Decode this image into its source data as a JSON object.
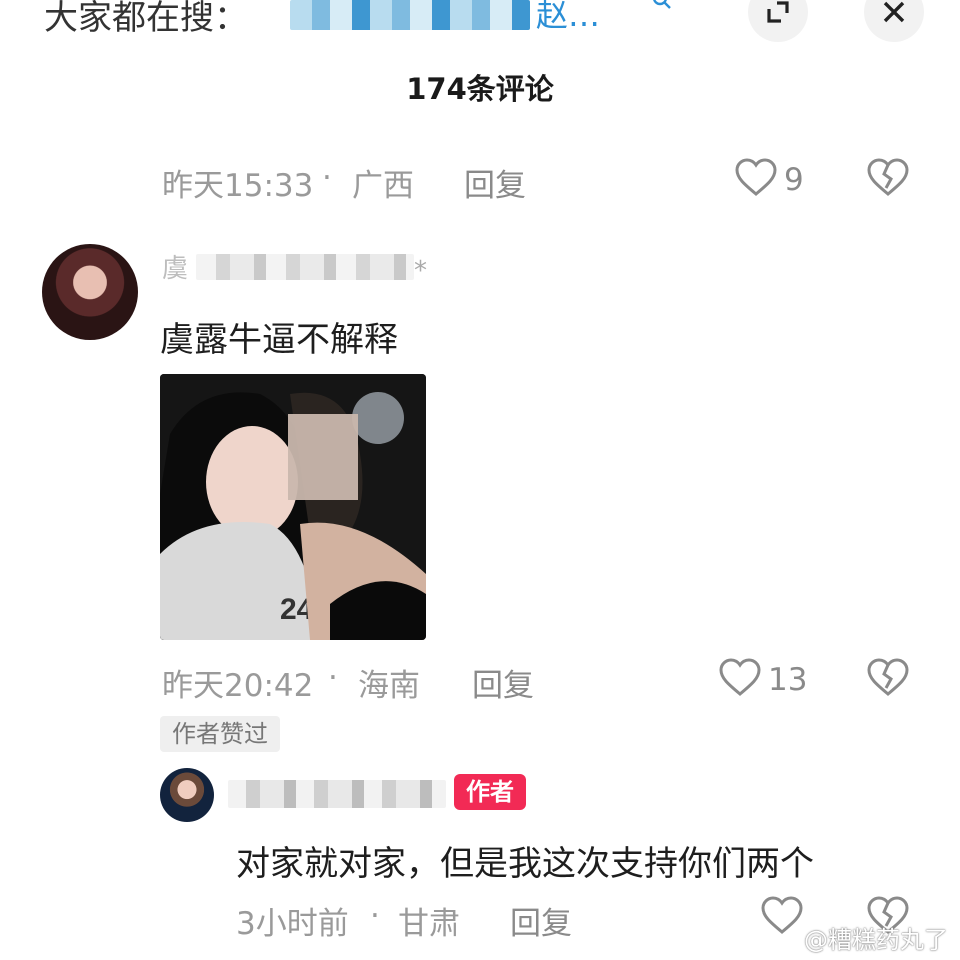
{
  "header": {
    "search_prefix": "大家都在搜：",
    "search_suffix": "赵…",
    "comment_count": "174条评论"
  },
  "comment_prev": {
    "time": "昨天15:33",
    "location": "广西",
    "reply_label": "回复",
    "likes": "9"
  },
  "comment_main": {
    "username_visible": "虞",
    "text": "虞露牛逼不解释",
    "time": "昨天20:42",
    "location": "海南",
    "reply_label": "回复",
    "likes": "13",
    "author_liked_badge": "作者赞过"
  },
  "reply": {
    "author_badge": "作者",
    "text": "对家就对家，但是我这次支持你们两个",
    "time": "3小时前",
    "location": "甘肃",
    "reply_label": "回复"
  },
  "separator": "·",
  "watermark": "@糟糕药丸了",
  "colors": {
    "author_badge": "#f22a55",
    "search_link": "#2b8fd6",
    "meta_gray": "#9a9a9a"
  }
}
